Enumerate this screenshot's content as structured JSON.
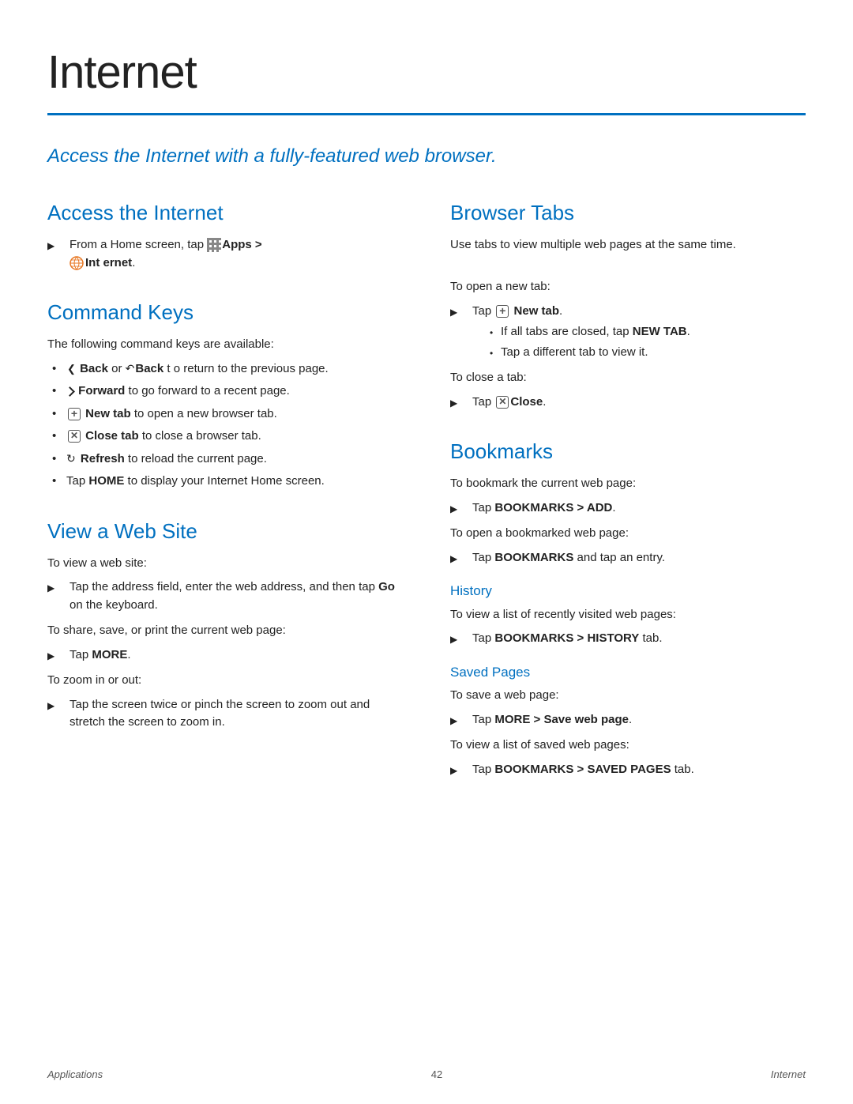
{
  "page": {
    "title": "Internet",
    "tagline": "Access the Internet with a fully-featured web browser.",
    "footer_left": "Applications",
    "footer_page": "42",
    "footer_right": "Internet"
  },
  "sections": {
    "access_internet": {
      "title": "Access the Internet",
      "step": "From a Home screen, tap",
      "apps_label": "Apps >",
      "internet_label": "Int ernet."
    },
    "command_keys": {
      "title": "Command Keys",
      "intro": "The following command keys are available:",
      "items": [
        "Back or  Back t o return to the previous page.",
        "Forward to go forward to a recent page.",
        " New tab to open a new browser tab.",
        " Close tab to close a browser tab.",
        " Refresh to reload the current page.",
        "Tap HOME to display your Internet Home screen."
      ]
    },
    "view_web_site": {
      "title": "View a Web Site",
      "to_view": "To view a web site:",
      "step1": "Tap the address field, enter the web address, and then tap Go on the keyboard.",
      "to_share": "To share, save, or print the current web page:",
      "step2": "Tap MORE.",
      "to_zoom": "To zoom in or out:",
      "step3": "Tap the screen twice or pinch the screen to zoom out and stretch the screen to zoom in."
    },
    "browser_tabs": {
      "title": "Browser Tabs",
      "intro": "Use tabs to view multiple web pages at the same time.",
      "to_open": "To open a new tab:",
      "step_open": " New tab.",
      "sub1": "If all tabs are closed, tap NEW TAB.",
      "sub2": "Tap a different tab to view it.",
      "to_close": "To close a tab:",
      "step_close": " Close."
    },
    "bookmarks": {
      "title": "Bookmarks",
      "to_bookmark": "To bookmark the current web page:",
      "step_bookmark": "Tap BOOKMARKS > ADD.",
      "to_open": "To open a bookmarked web page:",
      "step_open": "Tap BOOKMARKS and tap an entry.",
      "history": {
        "title": "History",
        "to_view": "To view a list of recently visited web pages:",
        "step": "Tap BOOKMARKS > HISTORY tab."
      },
      "saved_pages": {
        "title": "Saved Pages",
        "to_save": "To save a web page:",
        "step_save": "Tap MORE > Save web page.",
        "to_view": "To view a list of saved web pages:",
        "step_view": "Tap BOOKMARKS > SAVED PAGES tab."
      }
    }
  }
}
